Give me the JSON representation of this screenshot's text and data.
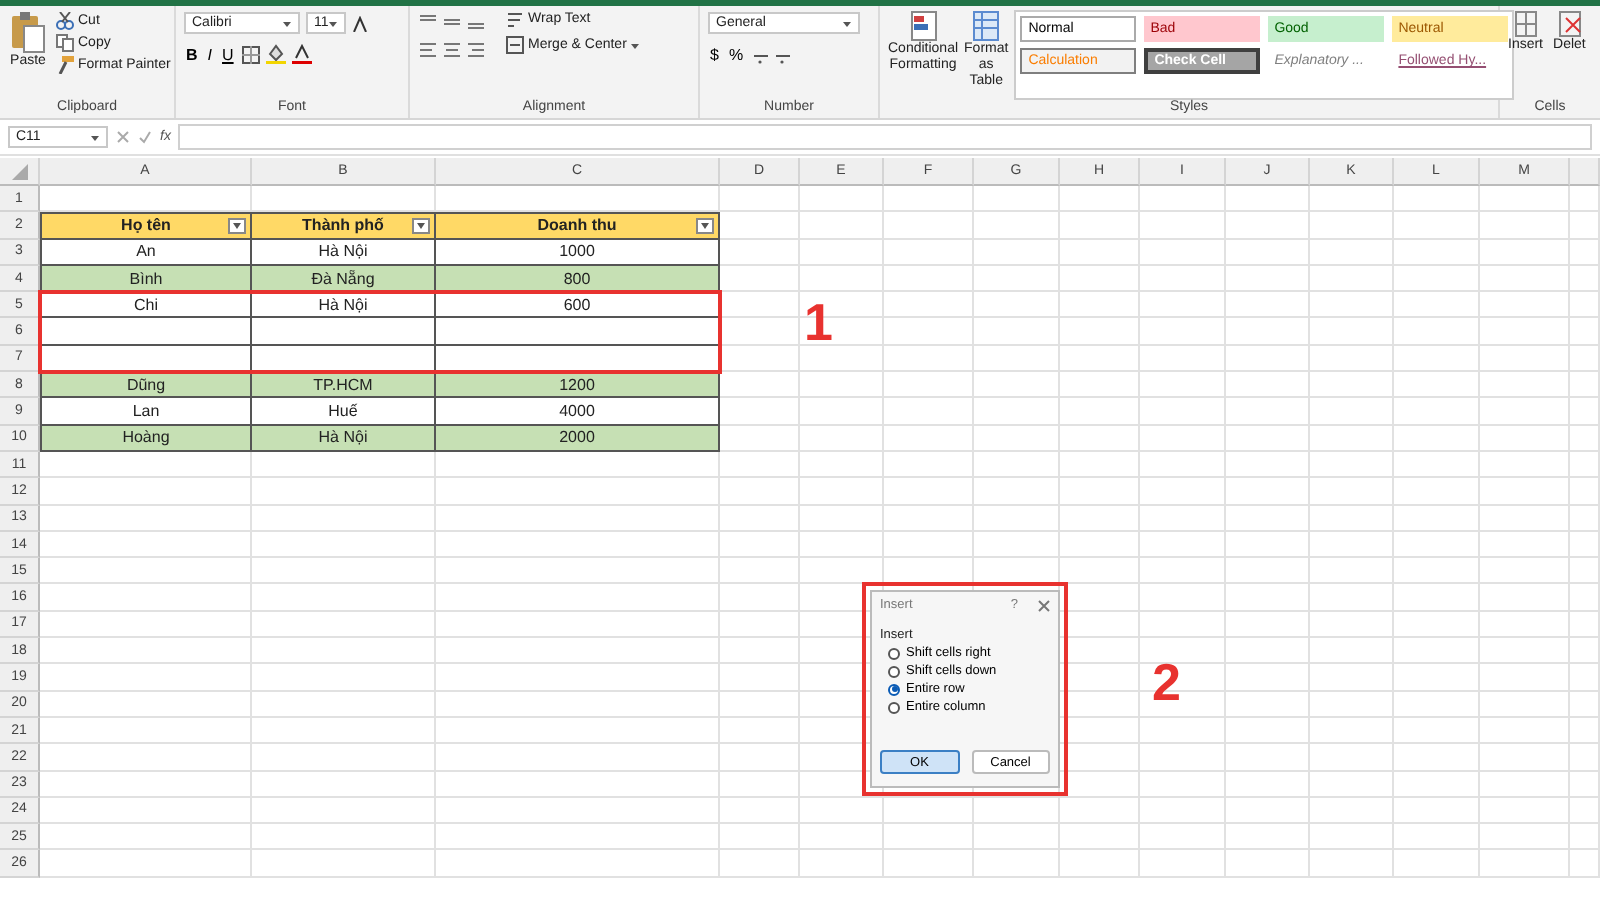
{
  "ribbon": {
    "clipboard": {
      "label": "Clipboard",
      "paste": "Paste",
      "cut": "Cut",
      "copy": "Copy",
      "format_painter": "Format Painter"
    },
    "font": {
      "label": "Font",
      "family": "Calibri",
      "size": "11",
      "bold": "B",
      "italic": "I",
      "underline": "U"
    },
    "alignment": {
      "label": "Alignment",
      "wrap_text": "Wrap Text",
      "merge_center": "Merge & Center"
    },
    "number": {
      "label": "Number",
      "format": "General",
      "currency": "$",
      "percent": "%"
    },
    "styles": {
      "label": "Styles",
      "conditional_formatting": "Conditional Formatting",
      "format_as_table": "Format as Table",
      "cell_styles": [
        {
          "text": "Normal",
          "kind": "normal"
        },
        {
          "text": "Bad",
          "kind": "bad"
        },
        {
          "text": "Good",
          "kind": "good"
        },
        {
          "text": "Neutral",
          "kind": "neutral"
        },
        {
          "text": "Calculation",
          "kind": "calculation"
        },
        {
          "text": "Check Cell",
          "kind": "check"
        },
        {
          "text": "Explanatory ...",
          "kind": "explanatory"
        },
        {
          "text": "Followed Hy...",
          "kind": "followed"
        }
      ]
    },
    "cells": {
      "label": "Cells",
      "insert": "Insert",
      "delete": "Delet"
    }
  },
  "formula_bar": {
    "name_box": "C11",
    "fx": "fx"
  },
  "sheet": {
    "columns": [
      "A",
      "B",
      "C",
      "D",
      "E",
      "F",
      "G",
      "H",
      "I",
      "J",
      "K",
      "L",
      "M"
    ],
    "row_numbers": [
      "1",
      "2",
      "3",
      "4",
      "5",
      "6",
      "7",
      "8",
      "9",
      "10",
      "11",
      "12",
      "13",
      "14",
      "15",
      "16",
      "17",
      "18",
      "19",
      "20",
      "21",
      "22",
      "23",
      "24",
      "25",
      "26"
    ]
  },
  "table": {
    "header": [
      "Họ tên",
      "Thành phố",
      "Doanh thu"
    ],
    "rows": [
      {
        "cells": [
          "An",
          "Hà Nội",
          "1000"
        ],
        "shaded": false
      },
      {
        "cells": [
          "Bình",
          "Đà Nẵng",
          "800"
        ],
        "shaded": true
      },
      {
        "cells": [
          "Chi",
          "Hà Nội",
          "600"
        ],
        "shaded": false
      },
      {
        "cells": [
          "",
          "",
          ""
        ],
        "shaded": false
      },
      {
        "cells": [
          "",
          "",
          ""
        ],
        "shaded": false
      },
      {
        "cells": [
          "Dũng",
          "TP.HCM",
          "1200"
        ],
        "shaded": true
      },
      {
        "cells": [
          "Lan",
          "Huế",
          "4000"
        ],
        "shaded": false
      },
      {
        "cells": [
          "Hoàng",
          "Hà Nội",
          "2000"
        ],
        "shaded": true
      }
    ]
  },
  "annotations": [
    "1",
    "2"
  ],
  "dialog": {
    "title": "Insert",
    "help": "?",
    "section": "Insert",
    "options": [
      {
        "label": "Shift cells right",
        "selected": false
      },
      {
        "label": "Shift cells down",
        "selected": false
      },
      {
        "label": "Entire row",
        "selected": true
      },
      {
        "label": "Entire column",
        "selected": false
      }
    ],
    "ok": "OK",
    "cancel": "Cancel"
  }
}
